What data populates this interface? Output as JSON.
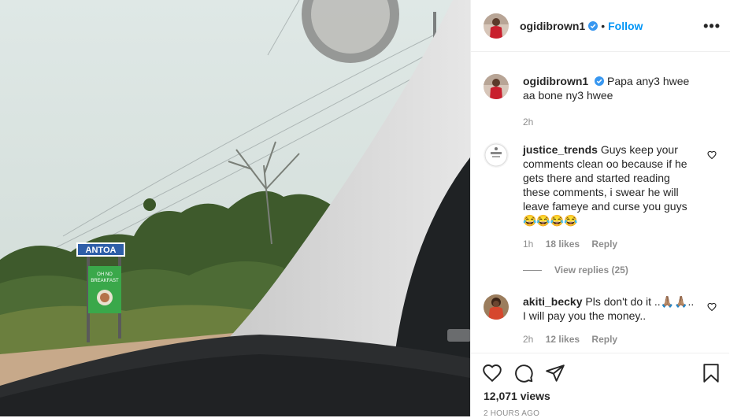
{
  "header": {
    "username": "ogidibrown1",
    "separator": "•",
    "follow_label": "Follow",
    "more_label": "•••"
  },
  "media": {
    "sign_text": "ANTOA",
    "billboard_text_1": "OH NO",
    "billboard_text_2": "BREAKFAST"
  },
  "caption": {
    "username": "ogidibrown1",
    "text": "Papa any3 hwee aa bone ny3 hwee",
    "time": "2h"
  },
  "comments": [
    {
      "username": "justice_trends",
      "text": "Guys keep your comments clean oo because if he gets there and started reading these comments, i swear he will leave fameye and curse you guys 😂😂😂😂",
      "time": "1h",
      "likes": "18 likes",
      "reply": "Reply",
      "view_replies": "View replies (25)"
    },
    {
      "username": "akiti_becky",
      "text": "Pls don't do it ..🙏🏽🙏🏽.. I will pay you the money..",
      "time": "2h",
      "likes": "12 likes",
      "reply": "Reply"
    }
  ],
  "footer": {
    "views": "12,071 views",
    "posted_ago": "2 HOURS AGO"
  },
  "icons": {
    "like": "heart-icon",
    "comment": "comment-icon",
    "share": "share-icon",
    "save": "bookmark-icon",
    "verified": "verified-badge-icon"
  },
  "colors": {
    "accent": "#0095f6",
    "text": "#262626",
    "muted": "#8e8e8e"
  }
}
